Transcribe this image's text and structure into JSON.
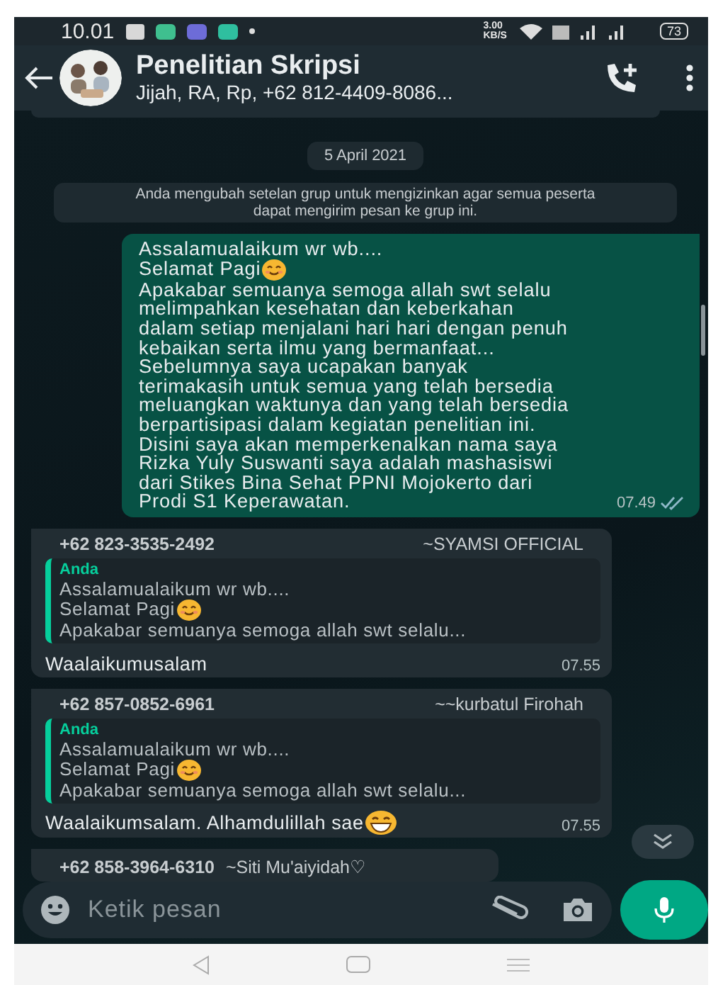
{
  "status_bar": {
    "time": "10.01",
    "speed": "3.00",
    "speed_unit": "KB/S",
    "battery": "73"
  },
  "header": {
    "title": "Penelitian Skripsi",
    "subtitle": "Jijah, RA, Rp, +62 812-4409-8086..."
  },
  "messages": [
    {
      "kind": "clipped"
    },
    {
      "kind": "date",
      "text": "5 April 2021"
    },
    {
      "kind": "system",
      "text": "Anda mengubah setelan grup untuk mengizinkan agar semua peserta dapat mengirim pesan ke grup ini."
    },
    {
      "kind": "outgoing",
      "lines": [
        {
          "text": "Assalamualaikum wr wb...."
        },
        {
          "text": "Selamat Pagi",
          "emoji": {
            "kind": "smile"
          }
        },
        {
          "text": "Apakabar semuanya semoga allah swt selalu"
        },
        {
          "text": "melimpahkan kesehatan dan keberkahan"
        },
        {
          "text": "dalam setiap menjalani hari hari dengan penuh"
        },
        {
          "text": "kebaikan serta ilmu yang bermanfaat..."
        },
        {
          "text": "Sebelumnya saya ucapakan banyak"
        },
        {
          "text": "terimakasih untuk semua yang telah bersedia"
        },
        {
          "text": "meluangkan waktunya dan yang telah bersedia"
        },
        {
          "text": "berpartisipasi dalam kegiatan penelitian ini."
        },
        {
          "text": "Disini saya akan memperkenalkan nama saya"
        },
        {
          "text": "Rizka Yuly Suswanti saya adalah mashasiswi"
        },
        {
          "text": "dari Stikes Bina Sehat PPNI Mojokerto dari"
        },
        {
          "text": "Prodi S1 Keperawatan."
        }
      ],
      "time": "07.49",
      "read": true
    },
    {
      "kind": "incoming",
      "sender": "+62 823-3535-2492",
      "name": "~SYAMSI OFFICIAL",
      "quote": {
        "author": "Anda",
        "lines": [
          {
            "text": "Assalamualaikum wr wb...."
          },
          {
            "text": "Selamat Pagi",
            "emoji": {
              "kind": "smile"
            }
          },
          {
            "text": "Apakabar semuanya semoga allah swt selalu..."
          }
        ]
      },
      "text": "Waalaikumusalam",
      "time": "07.55"
    },
    {
      "kind": "incoming",
      "sender": "+62 857-0852-6961",
      "name": "~~kurbatul Firohah",
      "quote": {
        "author": "Anda",
        "lines": [
          {
            "text": "Assalamualaikum wr wb...."
          },
          {
            "text": "Selamat Pagi",
            "emoji": {
              "kind": "smile"
            }
          },
          {
            "text": "Apakabar semuanya semoga allah swt selalu..."
          }
        ]
      },
      "text": "Waalaikumsalam. Alhamdulillah sae",
      "emoji": {
        "kind": "grin"
      },
      "time": "07.55"
    },
    {
      "kind": "incoming_cut",
      "sender": "+62 858-3964-6310",
      "name": "~Siti Mu'aiyidah♡"
    }
  ],
  "composer": {
    "placeholder": "Ketik pesan"
  }
}
